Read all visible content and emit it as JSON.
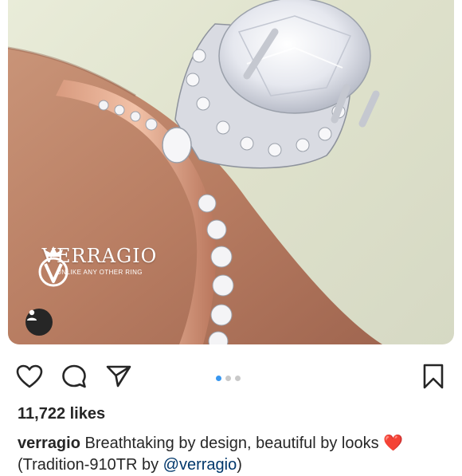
{
  "post": {
    "brand_logo": {
      "name": "VERRAGIO",
      "tagline": "UNLIKE ANY OTHER RING"
    },
    "likes": "11,722 likes",
    "caption": {
      "username": "verragio",
      "text": " Breathtaking by design, beautiful by looks ",
      "emoji": "❤️",
      "text_after": " (Tradition-910TR by ",
      "mention": "@verragio",
      "text_end": ")"
    },
    "carousel": {
      "total": 3,
      "active": 1
    }
  },
  "icons": {
    "like": "heart-icon",
    "comment": "comment-icon",
    "share": "send-icon",
    "save": "bookmark-icon",
    "tagged": "user-icon"
  },
  "colors": {
    "carousel_active": "#3897f0",
    "carousel_inactive": "#c9c9c9",
    "text": "#262626",
    "mention": "#00376b"
  }
}
